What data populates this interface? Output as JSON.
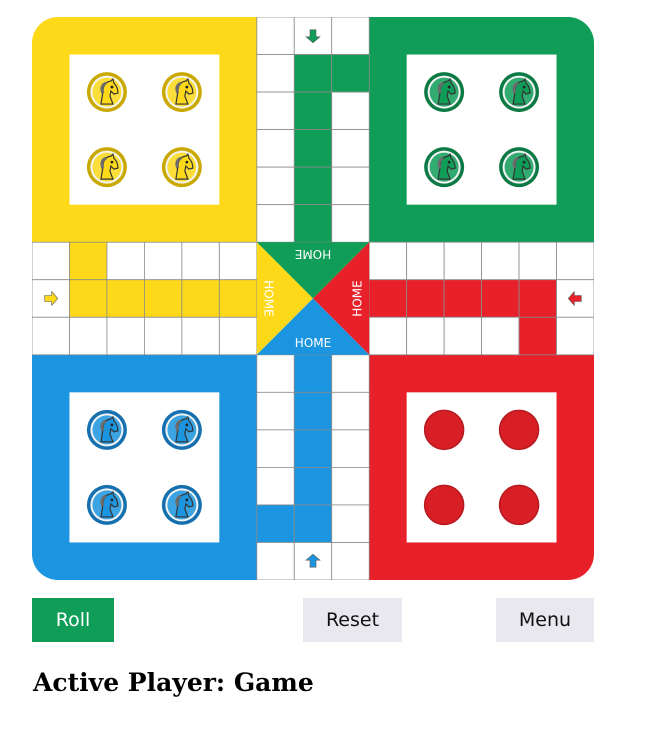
{
  "board": {
    "colors": {
      "yellow": "#fdd919",
      "green": "#0f9d58",
      "red": "#e8202a",
      "blue": "#1c95e0",
      "cell_border": "#8a8a8a",
      "white": "#ffffff"
    },
    "home_labels": {
      "green": "HOME",
      "yellow": "HOME",
      "red": "HOME",
      "blue": "HOME"
    },
    "yards": [
      {
        "color": "yellow",
        "tokens": [
          "horse-token",
          "horse-token",
          "horse-token",
          "horse-token"
        ]
      },
      {
        "color": "green",
        "tokens": [
          "horse-token",
          "horse-token",
          "horse-token",
          "horse-token"
        ]
      },
      {
        "color": "blue",
        "tokens": [
          "horse-token",
          "horse-token",
          "horse-token",
          "horse-token"
        ]
      },
      {
        "color": "red",
        "tokens": [
          "disc-token",
          "disc-token",
          "disc-token",
          "disc-token"
        ]
      }
    ],
    "entry_arrows": {
      "green": "arrow-down-icon",
      "yellow": "arrow-right-icon",
      "red": "arrow-left-icon",
      "blue": "arrow-up-icon"
    }
  },
  "controls": {
    "roll_label": "Roll",
    "reset_label": "Reset",
    "menu_label": "Menu"
  },
  "status": {
    "text": "Active Player: Game"
  }
}
